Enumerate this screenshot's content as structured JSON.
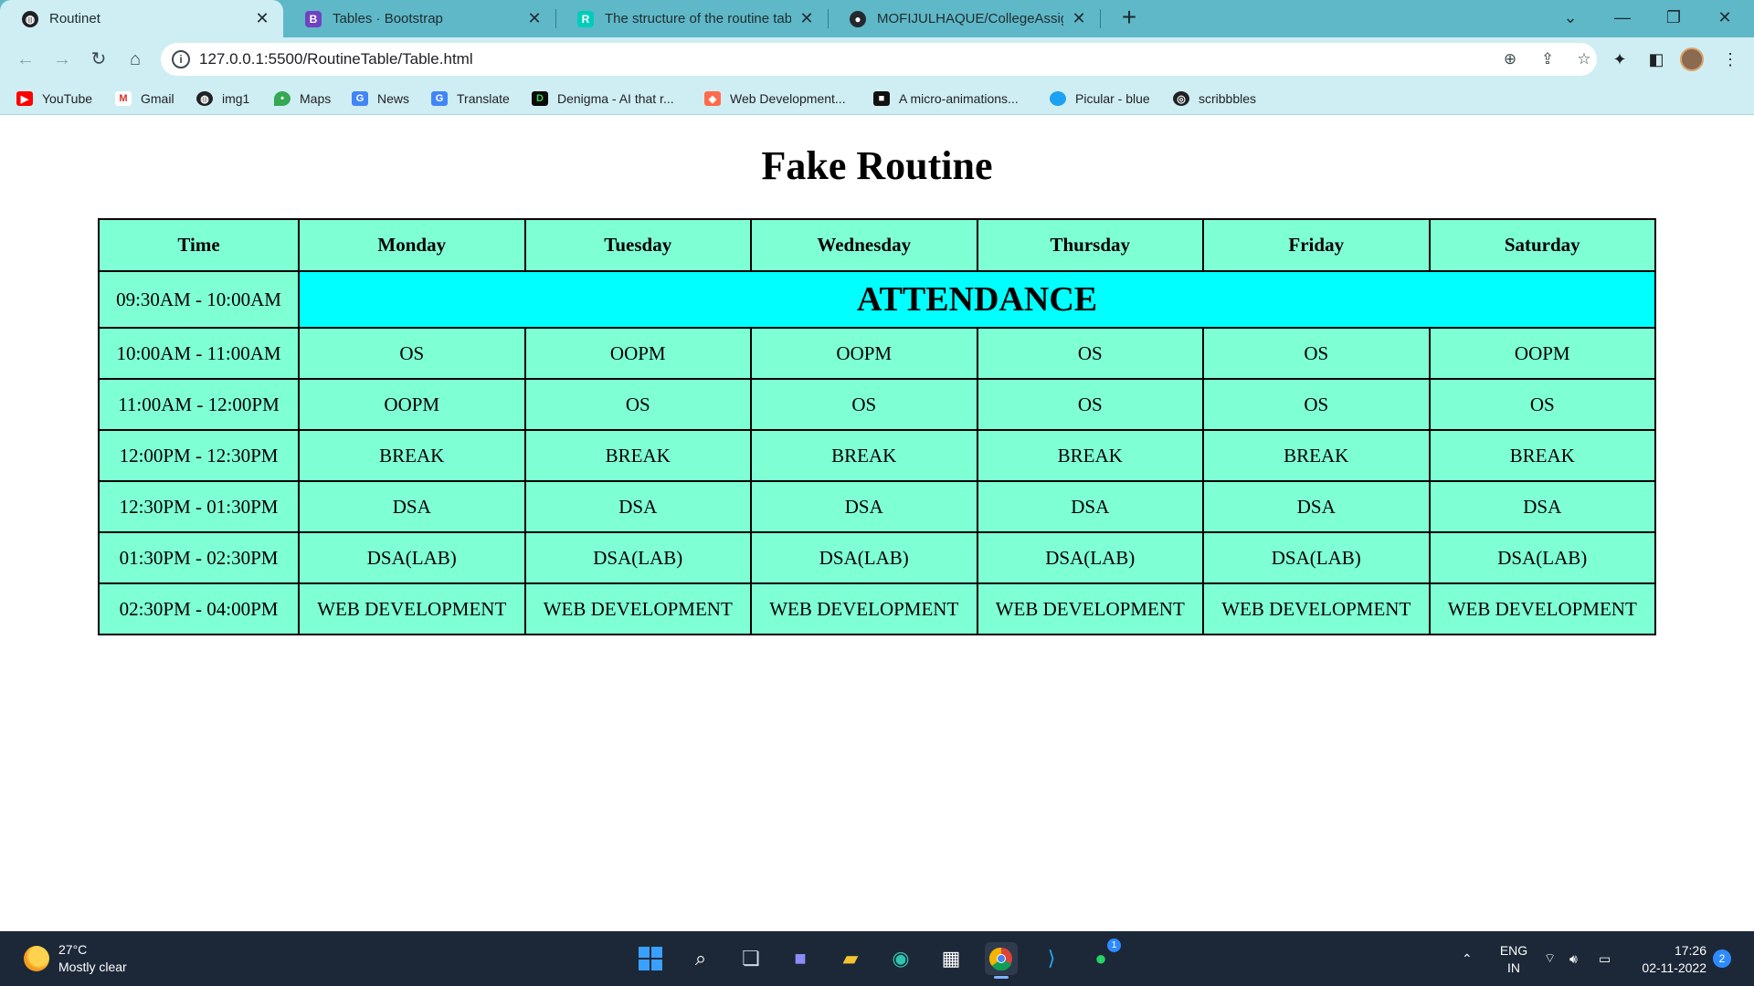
{
  "browser": {
    "tabs": [
      {
        "title": "Routinet",
        "icon": "globe-icon"
      },
      {
        "title": "Tables · Bootstrap",
        "icon": "bootstrap-icon"
      },
      {
        "title": "The structure of the routine table",
        "icon": "researchgate-icon"
      },
      {
        "title": "MOFIJULHAQUE/CollegeAssignm",
        "icon": "github-icon"
      }
    ],
    "url": "127.0.0.1:5500/RoutineTable/Table.html",
    "bookmarks": [
      {
        "label": "YouTube",
        "icon": "youtube-icon"
      },
      {
        "label": "Gmail",
        "icon": "gmail-icon"
      },
      {
        "label": "img1",
        "icon": "globe-icon"
      },
      {
        "label": "Maps",
        "icon": "maps-icon"
      },
      {
        "label": "News",
        "icon": "news-icon"
      },
      {
        "label": "Translate",
        "icon": "translate-icon"
      },
      {
        "label": "Denigma - AI that r...",
        "icon": "denigma-icon"
      },
      {
        "label": "Web Development...",
        "icon": "web-dev-icon"
      },
      {
        "label": "A micro-animations...",
        "icon": "micro-animations-icon"
      },
      {
        "label": "Picular - blue",
        "icon": "picular-icon"
      },
      {
        "label": "scribbbles",
        "icon": "scribbbles-icon"
      }
    ]
  },
  "page": {
    "title": "Fake Routine",
    "table": {
      "headers": [
        "Time",
        "Monday",
        "Tuesday",
        "Wednesday",
        "Thursday",
        "Friday",
        "Saturday"
      ],
      "attendance_row": {
        "time": "09:30AM - 10:00AM",
        "label": "ATTENDANCE"
      },
      "rows": [
        {
          "time": "10:00AM - 11:00AM",
          "cells": [
            "OS",
            "OOPM",
            "OOPM",
            "OS",
            "OS",
            "OOPM"
          ]
        },
        {
          "time": "11:00AM - 12:00PM",
          "cells": [
            "OOPM",
            "OS",
            "OS",
            "OS",
            "OS",
            "OS"
          ]
        },
        {
          "time": "12:00PM - 12:30PM",
          "cells": [
            "BREAK",
            "BREAK",
            "BREAK",
            "BREAK",
            "BREAK",
            "BREAK"
          ]
        },
        {
          "time": "12:30PM - 01:30PM",
          "cells": [
            "DSA",
            "DSA",
            "DSA",
            "DSA",
            "DSA",
            "DSA"
          ]
        },
        {
          "time": "01:30PM - 02:30PM",
          "cells": [
            "DSA(LAB)",
            "DSA(LAB)",
            "DSA(LAB)",
            "DSA(LAB)",
            "DSA(LAB)",
            "DSA(LAB)"
          ]
        },
        {
          "time": "02:30PM - 04:00PM",
          "cells": [
            "WEB DEVELOPMENT",
            "WEB DEVELOPMENT",
            "WEB DEVELOPMENT",
            "WEB DEVELOPMENT",
            "WEB DEVELOPMENT",
            "WEB DEVELOPMENT"
          ]
        }
      ]
    },
    "colors": {
      "cell_bg": "#7fffd4",
      "attendance_bg": "#00ffff"
    }
  },
  "taskbar": {
    "weather": {
      "temp": "27°C",
      "condition": "Mostly clear"
    },
    "lang": {
      "line1": "ENG",
      "line2": "IN"
    },
    "clock": {
      "time": "17:26",
      "date": "02-11-2022"
    },
    "notification_count": "2",
    "whatsapp_badge": "1"
  }
}
